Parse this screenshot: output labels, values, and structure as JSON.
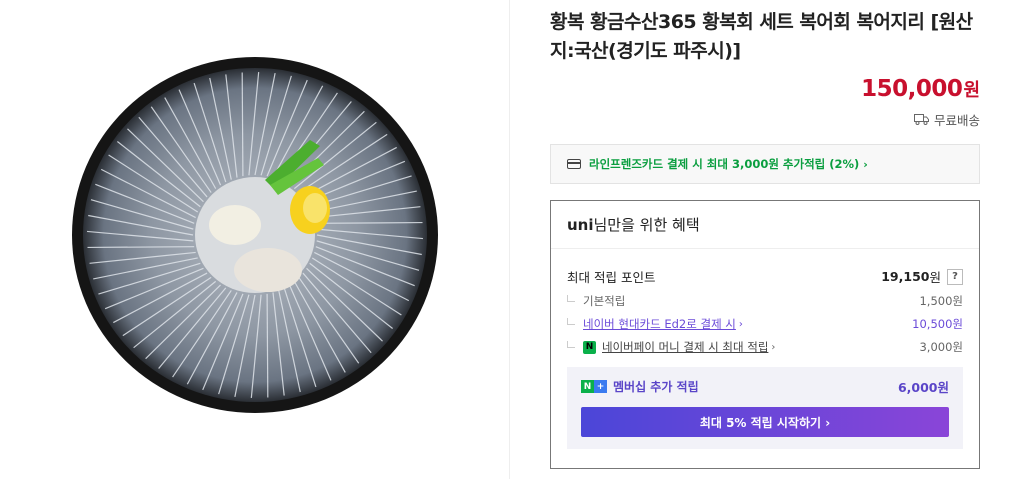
{
  "product": {
    "image_alt": "황복회 세트",
    "title": "황복 황금수산365 황복회 세트 복어회 복어지리 [원산지:국산(경기도 파주시)]",
    "price": "150,000",
    "currency": "원",
    "shipping": "무료배송"
  },
  "card_banner": {
    "text": "라인프렌즈카드 결제 시 최대 3,000원 추가적립 (2%)",
    "chevron": "›"
  },
  "benefits": {
    "user": "uni",
    "heading_suffix": "님만을 위한 혜택",
    "max_label": "최대 적립 포인트",
    "max_value": "19,150",
    "max_unit": "원",
    "help": "?",
    "rows": [
      {
        "label": "기본적립",
        "value": "1,500원"
      },
      {
        "label": "네이버 현대카드 Ed2로 결제 시",
        "value": "10,500원"
      },
      {
        "label": "네이버페이 머니 결제 시 최대 적립",
        "value": "3,000원"
      }
    ],
    "npay_badge": "N",
    "membership": {
      "badge_n": "N",
      "badge_plus": "+",
      "label": "멤버십 추가 적립",
      "value": "6,000원",
      "button": "최대 5% 적립 시작하기 ›"
    }
  },
  "colors": {
    "price_red": "#c8102e",
    "green": "#0a9e3f",
    "purple": "#6b4bd8"
  }
}
